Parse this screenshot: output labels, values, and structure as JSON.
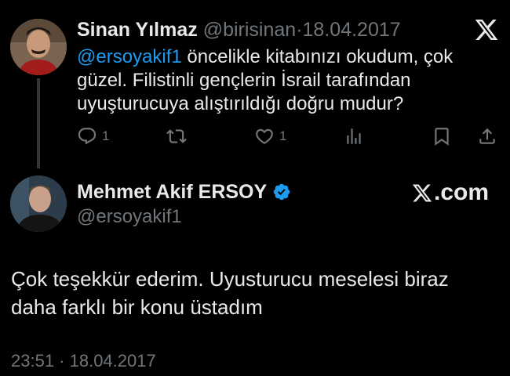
{
  "brand": {
    "logo_icon": "x-logo-icon",
    "site_text": ".com"
  },
  "reply_tweet": {
    "author_name": "Sinan Yılmaz",
    "handle": "@birisinan",
    "separator": "·",
    "date": "18.04.2017",
    "mention": "@ersoyakif1",
    "text": " öncelikle kitabınızı okudum, çok güzel. Filistinli gençlerin İsrail tarafından uyuşturucuya alıştırıldığı doğru mudur?",
    "actions": {
      "reply_icon": "reply-icon",
      "reply_count": "1",
      "retweet_icon": "retweet-icon",
      "like_icon": "heart-icon",
      "like_count": "1",
      "views_icon": "views-icon",
      "bookmark_icon": "bookmark-icon",
      "share_icon": "share-icon"
    }
  },
  "main_tweet": {
    "author_name": "Mehmet Akif ERSOY",
    "verified_icon": "verified-badge-icon",
    "handle": "@ersoyakif1",
    "text": "Çok teşekkür ederim. Uyusturucu meselesi biraz daha farklı bir konu üstadım",
    "timestamp": "23:51 · 18.04.2017"
  },
  "colors": {
    "background": "#000000",
    "text": "#e7e9ea",
    "muted": "#71767b",
    "accent": "#1d9bf0"
  }
}
